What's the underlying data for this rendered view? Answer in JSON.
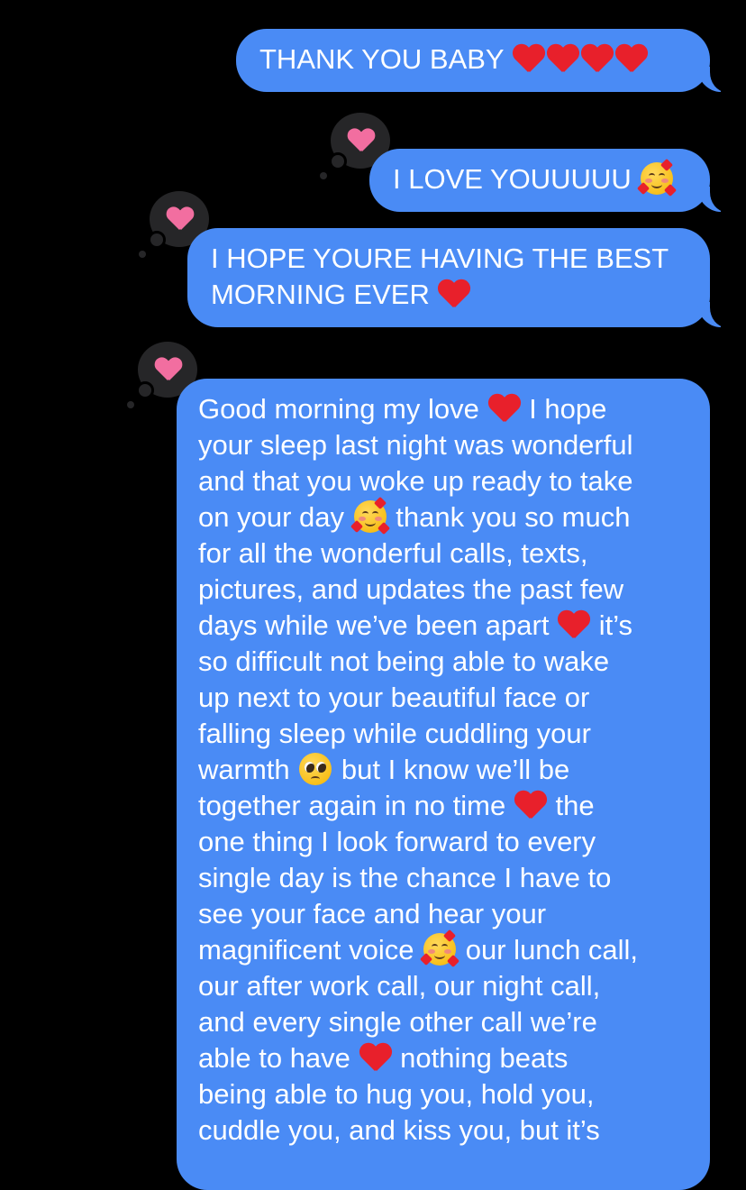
{
  "colors": {
    "background": "#000000",
    "sent_bubble": "#4a8bf5",
    "text": "#ffffff",
    "tapback_bg": "#262628",
    "tapback_heart": "#f26ea0"
  },
  "messages": [
    {
      "segments": [
        "THANK YOU BABY "
      ],
      "emoji": [
        "red-heart",
        "red-heart",
        "red-heart",
        "red-heart"
      ],
      "tapback": null
    },
    {
      "segments": [
        "I LOVE YOUUUUU "
      ],
      "emoji": [
        "smiling-face-with-hearts"
      ],
      "tapback": "heart"
    },
    {
      "segments": [
        "I HOPE YOURE HAVING THE BEST",
        "MORNING EVER "
      ],
      "emoji": [
        "red-heart"
      ],
      "tapback": "heart"
    },
    {
      "lines": [
        "Good morning my love",
        "I hope",
        "your sleep last night was wonderful",
        "and that you woke up ready to take",
        "on your day",
        "thank you so much",
        "for all the wonderful calls, texts,",
        "pictures, and updates the past few",
        "days while we’ve been apart",
        "it’s",
        "so difficult not being able to wake",
        "up next to your beautiful face or",
        "falling sleep while cuddling your",
        "warmth",
        "but I know we’ll be",
        "together again in no time",
        "the",
        "one thing I look forward to every",
        "single day is the chance I have to",
        "see your face and hear your",
        "magnificent voice",
        "our lunch call,",
        "our after work call, our night call,",
        "and every single other call we’re",
        "able to have",
        "nothing beats",
        "being able to hug you, hold you,",
        "cuddle you, and kiss you, but it’s"
      ],
      "emoji": [
        "red-heart",
        "smiling-face-with-hearts",
        "red-heart",
        "pleading-face",
        "red-heart",
        "smiling-face-with-hearts",
        "red-heart"
      ],
      "tapback": "heart"
    }
  ]
}
